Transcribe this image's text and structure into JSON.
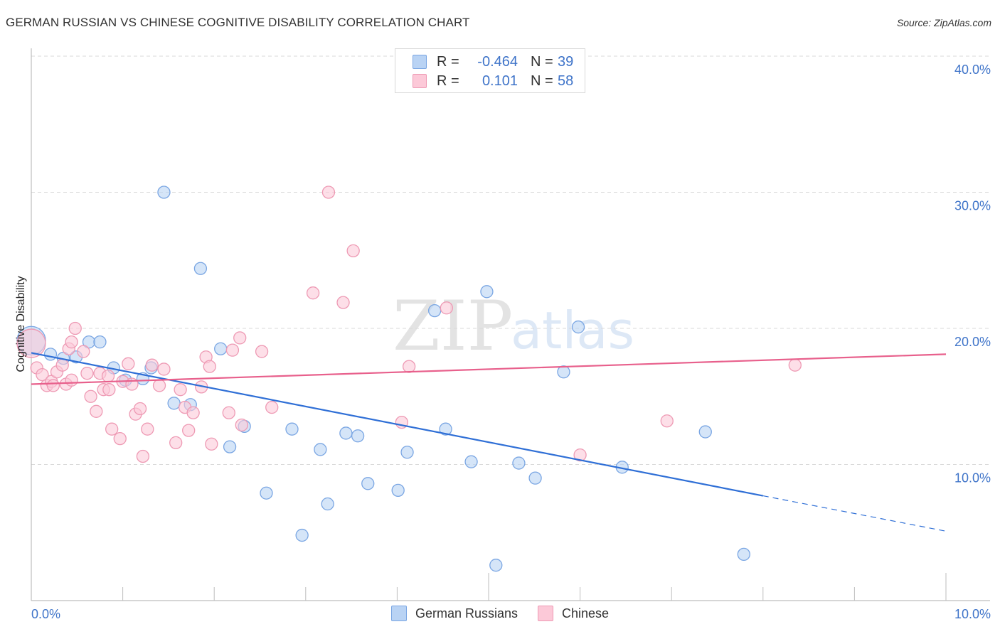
{
  "header": {
    "title": "GERMAN RUSSIAN VS CHINESE COGNITIVE DISABILITY CORRELATION CHART",
    "source": "Source: ZipAtlas.com"
  },
  "legend": {
    "rows": [
      {
        "series": "German Russians",
        "r_label": "R =",
        "r_value": "-0.464",
        "n_label": "N =",
        "n_value": "39",
        "fill": "#b9d3f4",
        "stroke": "#7aa6e3"
      },
      {
        "series": "Chinese",
        "r_label": "R =",
        "r_value": "0.101",
        "n_label": "N =",
        "n_value": "58",
        "fill": "#fcc9d8",
        "stroke": "#ee9ab4"
      }
    ]
  },
  "watermark": {
    "part1": "ZIP",
    "part2": "atlas"
  },
  "chart_data": {
    "type": "scatter",
    "title": "GERMAN RUSSIAN VS CHINESE COGNITIVE DISABILITY CORRELATION CHART",
    "xlabel": "",
    "ylabel": "Cognitive Disability",
    "xlim": [
      0,
      10
    ],
    "ylim": [
      0,
      40
    ],
    "x_tick_labels": [
      {
        "value": 0,
        "label": "0.0%"
      },
      {
        "value": 10,
        "label": "10.0%"
      }
    ],
    "x_minor_ticks": [
      0,
      1,
      2,
      3,
      4,
      5,
      6,
      7,
      8,
      9,
      10
    ],
    "y_ticks": [
      {
        "value": 10,
        "label": "10.0%"
      },
      {
        "value": 20,
        "label": "20.0%"
      },
      {
        "value": 30,
        "label": "30.0%"
      },
      {
        "value": 40,
        "label": "40.0%"
      }
    ],
    "grid": "horizontal-dashed",
    "legend_position": "bottom-center",
    "series": [
      {
        "name": "German Russians",
        "color": "#2f6fd6",
        "fill": "#b9d3f4",
        "stroke": "#7aa6e3",
        "r": -0.464,
        "n": 39,
        "trend": {
          "x0": 0,
          "y0": 18.2,
          "x_solid_end": 8.0,
          "y_solid_end": 7.7,
          "x1": 10,
          "y1": 5.1
        },
        "points": [
          [
            0.0,
            19.1,
            "large"
          ],
          [
            0.21,
            18.1
          ],
          [
            0.35,
            17.8
          ],
          [
            0.49,
            17.9
          ],
          [
            0.63,
            19.0
          ],
          [
            0.75,
            19.0
          ],
          [
            0.9,
            17.1
          ],
          [
            1.03,
            16.2
          ],
          [
            1.22,
            16.3
          ],
          [
            1.31,
            17.1
          ],
          [
            1.45,
            30.0
          ],
          [
            1.56,
            14.5
          ],
          [
            1.74,
            14.4
          ],
          [
            1.85,
            24.4
          ],
          [
            2.07,
            18.5
          ],
          [
            2.17,
            11.3
          ],
          [
            2.33,
            12.8
          ],
          [
            2.57,
            7.9
          ],
          [
            2.85,
            12.6
          ],
          [
            2.96,
            4.8
          ],
          [
            3.16,
            11.1
          ],
          [
            3.24,
            7.1
          ],
          [
            3.44,
            12.3
          ],
          [
            3.57,
            12.1
          ],
          [
            3.68,
            8.6
          ],
          [
            4.01,
            8.1
          ],
          [
            4.11,
            10.9
          ],
          [
            4.41,
            21.3
          ],
          [
            4.53,
            12.6
          ],
          [
            4.81,
            10.2
          ],
          [
            4.98,
            22.7
          ],
          [
            5.08,
            2.6
          ],
          [
            5.33,
            10.1
          ],
          [
            5.51,
            9.0
          ],
          [
            5.82,
            16.8
          ],
          [
            5.98,
            20.1
          ],
          [
            6.46,
            9.8
          ],
          [
            7.37,
            12.4
          ],
          [
            7.79,
            3.4
          ]
        ]
      },
      {
        "name": "Chinese",
        "color": "#e8608c",
        "fill": "#fcc9d8",
        "stroke": "#ee9ab4",
        "r": 0.101,
        "n": 58,
        "trend": {
          "x0": 0,
          "y0": 15.9,
          "x1": 10,
          "y1": 18.1
        },
        "points": [
          [
            0.0,
            18.9,
            "large"
          ],
          [
            0.06,
            17.1
          ],
          [
            0.12,
            16.6
          ],
          [
            0.17,
            15.8
          ],
          [
            0.22,
            16.1
          ],
          [
            0.24,
            15.8
          ],
          [
            0.28,
            16.8
          ],
          [
            0.34,
            17.3
          ],
          [
            0.38,
            15.9
          ],
          [
            0.41,
            18.5
          ],
          [
            0.44,
            16.2
          ],
          [
            0.48,
            20.0
          ],
          [
            0.57,
            18.3
          ],
          [
            0.61,
            16.7
          ],
          [
            0.65,
            15.0
          ],
          [
            0.71,
            13.9
          ],
          [
            0.75,
            16.7
          ],
          [
            0.79,
            15.5
          ],
          [
            0.84,
            16.5
          ],
          [
            0.85,
            15.5
          ],
          [
            0.88,
            12.6
          ],
          [
            0.97,
            11.9
          ],
          [
            1.0,
            16.1
          ],
          [
            1.06,
            17.4
          ],
          [
            1.1,
            15.9
          ],
          [
            1.14,
            13.7
          ],
          [
            1.19,
            14.1
          ],
          [
            1.22,
            10.6
          ],
          [
            1.27,
            12.6
          ],
          [
            1.32,
            17.3
          ],
          [
            1.4,
            15.8
          ],
          [
            1.45,
            17.0
          ],
          [
            1.58,
            11.6
          ],
          [
            1.63,
            15.5
          ],
          [
            1.68,
            14.2
          ],
          [
            1.72,
            12.5
          ],
          [
            1.77,
            13.8
          ],
          [
            1.86,
            15.7
          ],
          [
            1.91,
            17.9
          ],
          [
            1.95,
            17.2
          ],
          [
            1.97,
            11.5
          ],
          [
            2.16,
            13.8
          ],
          [
            2.2,
            18.4
          ],
          [
            2.28,
            19.3
          ],
          [
            2.3,
            12.9
          ],
          [
            2.52,
            18.3
          ],
          [
            2.63,
            14.2
          ],
          [
            3.08,
            22.6
          ],
          [
            3.25,
            30.0
          ],
          [
            3.41,
            21.9
          ],
          [
            3.52,
            25.7
          ],
          [
            4.05,
            13.1
          ],
          [
            4.13,
            17.2
          ],
          [
            4.54,
            21.5
          ],
          [
            6.0,
            10.7
          ],
          [
            6.95,
            13.2
          ],
          [
            8.35,
            17.3
          ],
          [
            0.44,
            19.0
          ]
        ]
      }
    ]
  }
}
